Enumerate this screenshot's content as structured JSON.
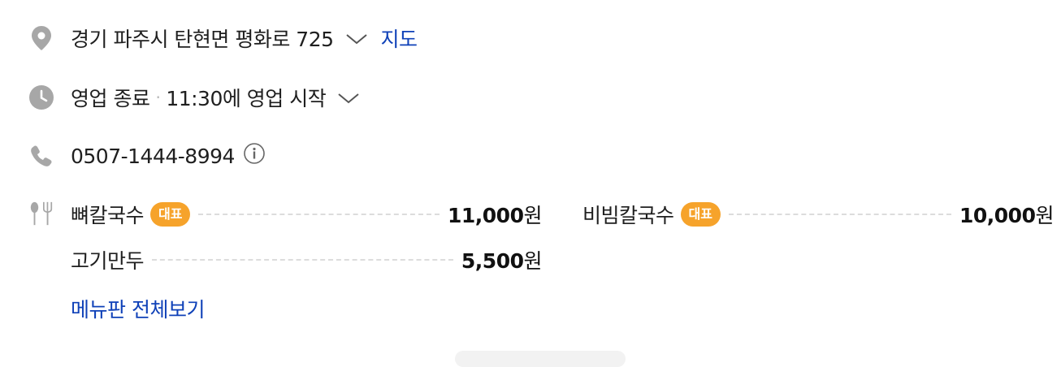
{
  "address": {
    "text": "경기 파주시 탄현면 평화로 725",
    "map_link": "지도",
    "icon": "location-pin-icon"
  },
  "hours": {
    "status": "영업 종료",
    "next": "11:30에 영업 시작",
    "separator": "·",
    "icon": "clock-icon"
  },
  "phone": {
    "number": "0507-1444-8994",
    "icon": "phone-icon"
  },
  "menu": {
    "icon": "utensils-icon",
    "badge_color": "#f6a32b",
    "items": [
      {
        "name": "뼈칼국수",
        "badge": "대표",
        "price": "11,000",
        "unit": "원"
      },
      {
        "name": "비빔칼국수",
        "badge": "대표",
        "price": "10,000",
        "unit": "원"
      },
      {
        "name": "고기만두",
        "badge": "",
        "price": "5,500",
        "unit": "원"
      }
    ],
    "view_all": "메뉴판 전체보기"
  },
  "colors": {
    "link": "#0f41b8",
    "icon_gray": "#a7a7a7"
  }
}
